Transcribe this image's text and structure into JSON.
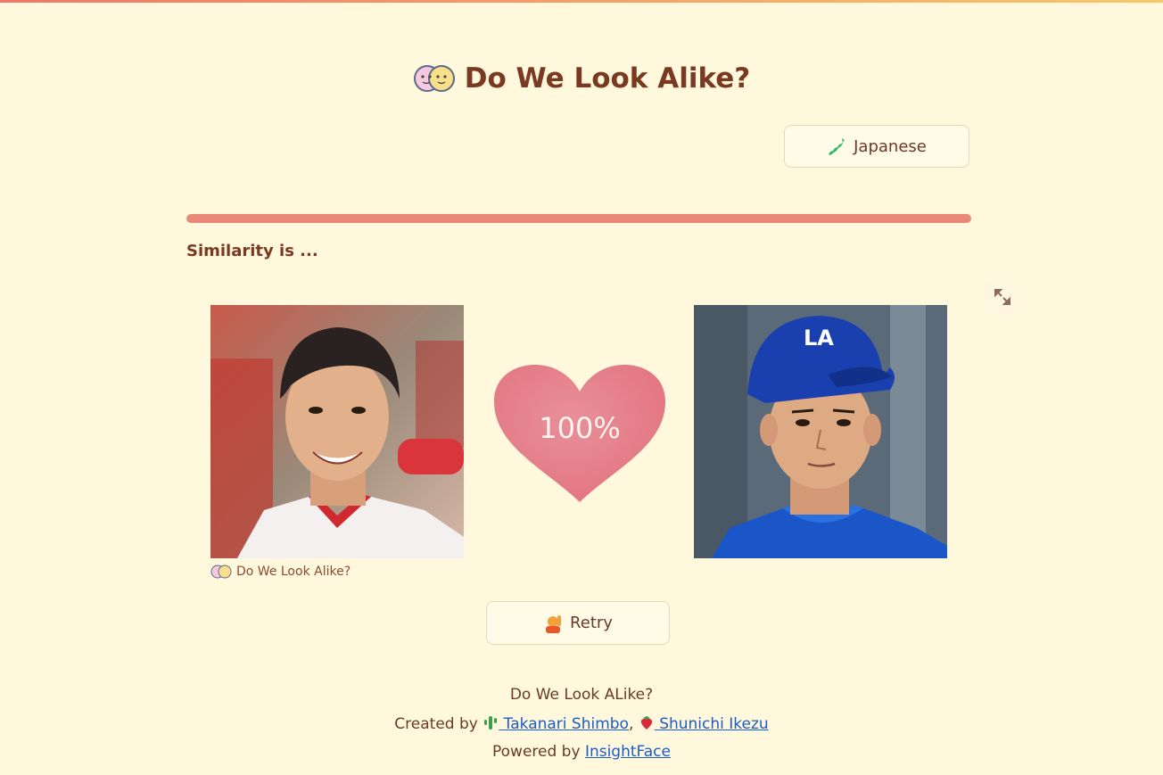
{
  "header": {
    "title": "Do We Look Alike?",
    "title_icon": "two-faces-icon"
  },
  "language_button": {
    "label": "Japanese",
    "icon": "japan-map-icon"
  },
  "progress": {
    "value_percent": 100
  },
  "result": {
    "heading": "Similarity is ...",
    "score": "100%",
    "caption": "Do We Look Alike?"
  },
  "retry_button": {
    "label": "Retry",
    "icon": "raising-hand-icon"
  },
  "footer": {
    "app_name": "Do We Look ALike?",
    "created_by_prefix": "Created by",
    "author1": "Takanari Shimbo",
    "author2": "Shunichi Ikezu",
    "separator": ",",
    "powered_by_prefix": "Powered by",
    "powered_by_link": "InsightFace"
  },
  "colors": {
    "background": "#fff8dc",
    "accent": "#e98a78",
    "text": "#7a3a22",
    "link": "#1a5cc8"
  }
}
